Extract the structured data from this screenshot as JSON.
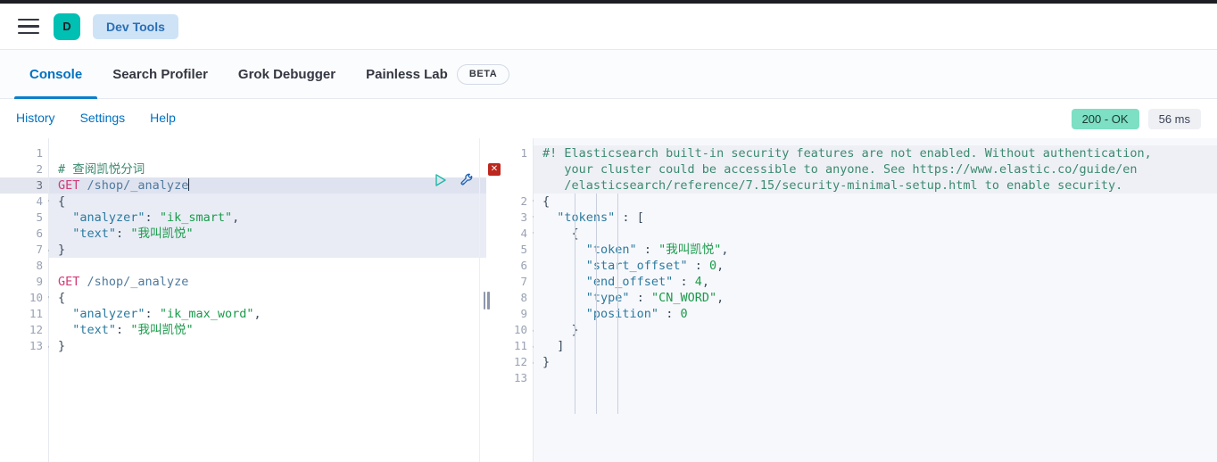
{
  "header": {
    "menu_icon": "hamburger-menu-icon",
    "avatar_initial": "D",
    "breadcrumb": "Dev Tools",
    "avatar_color": "#00bfb3",
    "breadcrumb_bg": "#cfe3f7"
  },
  "tabs": [
    {
      "label": "Console",
      "active": true
    },
    {
      "label": "Search Profiler",
      "active": false
    },
    {
      "label": "Grok Debugger",
      "active": false
    },
    {
      "label": "Painless Lab",
      "active": false,
      "badge": "BETA"
    }
  ],
  "console_bar": {
    "links": [
      "History",
      "Settings",
      "Help"
    ],
    "status_code": "200 - OK",
    "status_time": "56 ms",
    "status_color": "#7ddfc3"
  },
  "request_editor": {
    "name": "request-editor",
    "lines": [
      {
        "n": "1",
        "fold": "",
        "sel": false,
        "cur": false,
        "tokens": []
      },
      {
        "n": "2",
        "fold": "",
        "sel": false,
        "cur": false,
        "tokens": [
          {
            "t": "# 查阅凯悦分词",
            "c": "k-comment"
          }
        ]
      },
      {
        "n": "3",
        "fold": "",
        "sel": true,
        "cur": true,
        "tokens": [
          {
            "t": "GET",
            "c": "k-method"
          },
          {
            "t": " ",
            "c": "k-plain"
          },
          {
            "t": "/shop/_analyze",
            "c": "k-url"
          }
        ],
        "caret": true
      },
      {
        "n": "4",
        "fold": "▾",
        "sel": true,
        "cur": false,
        "tokens": [
          {
            "t": "{",
            "c": "k-punct"
          }
        ]
      },
      {
        "n": "5",
        "fold": "",
        "sel": true,
        "cur": false,
        "tokens": [
          {
            "t": "  ",
            "c": "k-plain"
          },
          {
            "t": "\"analyzer\"",
            "c": "k-key"
          },
          {
            "t": ": ",
            "c": "k-punct"
          },
          {
            "t": "\"ik_smart\"",
            "c": "k-str"
          },
          {
            "t": ",",
            "c": "k-punct"
          }
        ]
      },
      {
        "n": "6",
        "fold": "",
        "sel": true,
        "cur": false,
        "tokens": [
          {
            "t": "  ",
            "c": "k-plain"
          },
          {
            "t": "\"text\"",
            "c": "k-key"
          },
          {
            "t": ": ",
            "c": "k-punct"
          },
          {
            "t": "\"我叫凯悦\"",
            "c": "k-str"
          }
        ]
      },
      {
        "n": "7",
        "fold": "▴",
        "sel": true,
        "cur": false,
        "tokens": [
          {
            "t": "}",
            "c": "k-punct"
          }
        ]
      },
      {
        "n": "8",
        "fold": "",
        "sel": false,
        "cur": false,
        "tokens": []
      },
      {
        "n": "9",
        "fold": "",
        "sel": false,
        "cur": false,
        "tokens": [
          {
            "t": "GET",
            "c": "k-method"
          },
          {
            "t": " ",
            "c": "k-plain"
          },
          {
            "t": "/shop/_analyze",
            "c": "k-url"
          }
        ]
      },
      {
        "n": "10",
        "fold": "▾",
        "sel": false,
        "cur": false,
        "tokens": [
          {
            "t": "{",
            "c": "k-punct"
          }
        ]
      },
      {
        "n": "11",
        "fold": "",
        "sel": false,
        "cur": false,
        "tokens": [
          {
            "t": "  ",
            "c": "k-plain"
          },
          {
            "t": "\"analyzer\"",
            "c": "k-key"
          },
          {
            "t": ": ",
            "c": "k-punct"
          },
          {
            "t": "\"ik_max_word\"",
            "c": "k-str"
          },
          {
            "t": ",",
            "c": "k-punct"
          }
        ]
      },
      {
        "n": "12",
        "fold": "",
        "sel": false,
        "cur": false,
        "tokens": [
          {
            "t": "  ",
            "c": "k-plain"
          },
          {
            "t": "\"text\"",
            "c": "k-key"
          },
          {
            "t": ": ",
            "c": "k-punct"
          },
          {
            "t": "\"我叫凯悦\"",
            "c": "k-str"
          }
        ]
      },
      {
        "n": "13",
        "fold": "▴",
        "sel": false,
        "cur": false,
        "tokens": [
          {
            "t": "}",
            "c": "k-punct"
          }
        ]
      }
    ],
    "actions": [
      {
        "name": "send-request-play-icon",
        "title": "Click to send request"
      },
      {
        "name": "wrench-console-menu-icon",
        "title": "Open documentation"
      }
    ]
  },
  "response_editor": {
    "name": "response-editor",
    "lines": [
      {
        "n": "1",
        "fold": "",
        "warn": true,
        "err": false,
        "tokens": [
          {
            "t": "#! Elasticsearch built-in security features are not enabled. Without authentication,",
            "c": "k-warn"
          }
        ]
      },
      {
        "n": "",
        "fold": "",
        "warn": true,
        "err": true,
        "tokens": [
          {
            "t": "   your cluster could be accessible to anyone. See https://www.elastic.co/guide/en",
            "c": "k-warn"
          }
        ]
      },
      {
        "n": "",
        "fold": "",
        "warn": true,
        "err": false,
        "tokens": [
          {
            "t": "   /elasticsearch/reference/7.15/security-minimal-setup.html to enable security.",
            "c": "k-warn"
          }
        ]
      },
      {
        "n": "2",
        "fold": "▾",
        "warn": false,
        "err": false,
        "tokens": [
          {
            "t": "{",
            "c": "k-punct"
          }
        ]
      },
      {
        "n": "3",
        "fold": "▾",
        "warn": false,
        "err": false,
        "tokens": [
          {
            "t": "  ",
            "c": "k-plain"
          },
          {
            "t": "\"tokens\"",
            "c": "k-key"
          },
          {
            "t": " : ",
            "c": "k-punct"
          },
          {
            "t": "[",
            "c": "k-punct"
          }
        ]
      },
      {
        "n": "4",
        "fold": "▾",
        "warn": false,
        "err": false,
        "tokens": [
          {
            "t": "    ",
            "c": "k-plain"
          },
          {
            "t": "{",
            "c": "k-punct"
          }
        ]
      },
      {
        "n": "5",
        "fold": "",
        "warn": false,
        "err": false,
        "tokens": [
          {
            "t": "      ",
            "c": "k-plain"
          },
          {
            "t": "\"token\"",
            "c": "k-key"
          },
          {
            "t": " : ",
            "c": "k-punct"
          },
          {
            "t": "\"我叫凯悦\"",
            "c": "k-str"
          },
          {
            "t": ",",
            "c": "k-punct"
          }
        ]
      },
      {
        "n": "6",
        "fold": "",
        "warn": false,
        "err": false,
        "tokens": [
          {
            "t": "      ",
            "c": "k-plain"
          },
          {
            "t": "\"start_offset\"",
            "c": "k-key"
          },
          {
            "t": " : ",
            "c": "k-punct"
          },
          {
            "t": "0",
            "c": "k-num"
          },
          {
            "t": ",",
            "c": "k-punct"
          }
        ]
      },
      {
        "n": "7",
        "fold": "",
        "warn": false,
        "err": false,
        "tokens": [
          {
            "t": "      ",
            "c": "k-plain"
          },
          {
            "t": "\"end_offset\"",
            "c": "k-key"
          },
          {
            "t": " : ",
            "c": "k-punct"
          },
          {
            "t": "4",
            "c": "k-num"
          },
          {
            "t": ",",
            "c": "k-punct"
          }
        ]
      },
      {
        "n": "8",
        "fold": "",
        "warn": false,
        "err": false,
        "tokens": [
          {
            "t": "      ",
            "c": "k-plain"
          },
          {
            "t": "\"type\"",
            "c": "k-key"
          },
          {
            "t": " : ",
            "c": "k-punct"
          },
          {
            "t": "\"CN_WORD\"",
            "c": "k-str"
          },
          {
            "t": ",",
            "c": "k-punct"
          }
        ]
      },
      {
        "n": "9",
        "fold": "",
        "warn": false,
        "err": false,
        "tokens": [
          {
            "t": "      ",
            "c": "k-plain"
          },
          {
            "t": "\"position\"",
            "c": "k-key"
          },
          {
            "t": " : ",
            "c": "k-punct"
          },
          {
            "t": "0",
            "c": "k-num"
          }
        ]
      },
      {
        "n": "10",
        "fold": "▴",
        "warn": false,
        "err": false,
        "tokens": [
          {
            "t": "    ",
            "c": "k-plain"
          },
          {
            "t": "}",
            "c": "k-punct"
          }
        ]
      },
      {
        "n": "11",
        "fold": "▴",
        "warn": false,
        "err": false,
        "tokens": [
          {
            "t": "  ",
            "c": "k-plain"
          },
          {
            "t": "]",
            "c": "k-punct"
          }
        ]
      },
      {
        "n": "12",
        "fold": "▴",
        "warn": false,
        "err": false,
        "tokens": [
          {
            "t": "}",
            "c": "k-punct"
          }
        ]
      },
      {
        "n": "13",
        "fold": "",
        "warn": false,
        "err": false,
        "tokens": []
      }
    ]
  },
  "drag_handle": {
    "name": "pane-resize-handle"
  }
}
